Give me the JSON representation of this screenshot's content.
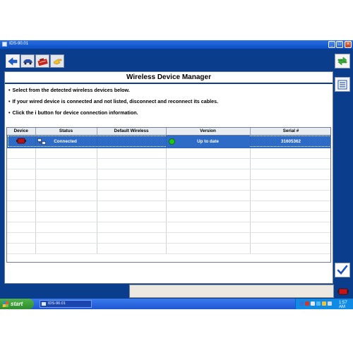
{
  "window": {
    "title": "IDS-90.01",
    "min_glyph": "_",
    "max_glyph": "□",
    "close_glyph": "×"
  },
  "toolbar": {
    "buttons": [
      "back-icon",
      "vehicle-icon",
      "toolbox-icon",
      "hand-pointer-icon"
    ]
  },
  "panel": {
    "title": "Wireless Device Manager",
    "instructions": [
      "Select from the detected wireless devices below.",
      "If your wired device is connected and not listed, disconnect and reconnect its cables.",
      "Click the i button for device connection information."
    ]
  },
  "table": {
    "columns": [
      "Device",
      "Status",
      "Default Wireless",
      "Version",
      "Serial #"
    ],
    "rows": [
      {
        "device_icon": "vcm-device-icon",
        "status_icon": "network-connection-icon",
        "status": "Connected",
        "default_wireless": "",
        "version_indicator": "green",
        "version": "Up to date",
        "serial": "31605362"
      }
    ]
  },
  "taskbar": {
    "start_label": "start",
    "task_item": "IDS-90.01",
    "clock": "1:57 AM"
  },
  "colors": {
    "desktop_blue": "#0a3d8c",
    "selected_row": "#2e6bc7",
    "status_ok": "#22c41c"
  }
}
